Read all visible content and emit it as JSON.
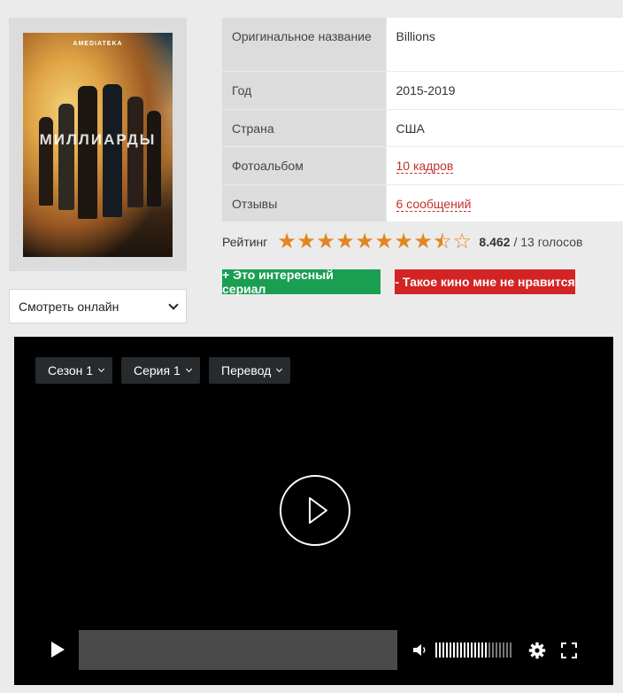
{
  "poster": {
    "brand": "AMEDIATEKA",
    "title": "МИЛЛИАРДЫ"
  },
  "watch_select": {
    "selected": "Смотреть онлайн"
  },
  "info": {
    "rows": [
      {
        "label": "Оригинальное название",
        "value": "Billions"
      },
      {
        "label": "Год",
        "value": "2015-2019"
      },
      {
        "label": "Страна",
        "value": "США"
      },
      {
        "label": "Фотоальбом",
        "value": "10 кадров"
      },
      {
        "label": "Отзывы",
        "value": "6 сообщений"
      }
    ]
  },
  "rating": {
    "label": "Рейтинг",
    "score": "8.462",
    "votes": "/ 13 голосов",
    "stars_total": 10,
    "stars_value": 8.462,
    "star_color": "#e3861f"
  },
  "buttons": {
    "like": "+ Это интересный сериал",
    "dislike": "- Такое кино мне не нравится"
  },
  "player": {
    "season": "Сезон 1",
    "episode": "Серия 1",
    "translation": "Перевод",
    "volume_level": 0.7
  },
  "colors": {
    "like": "#1a9e52",
    "dislike": "#d42323",
    "link": "#c1332a"
  }
}
